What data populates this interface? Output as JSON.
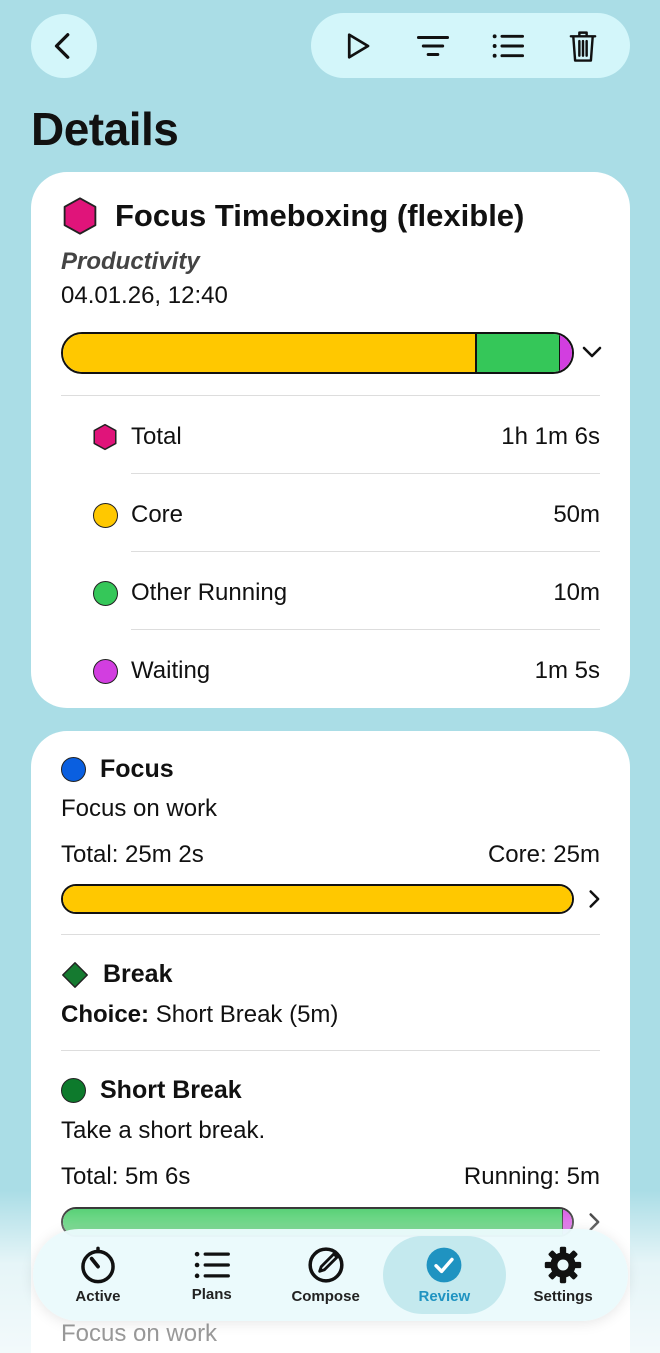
{
  "header": {
    "title": "Details",
    "icons": [
      "back-icon",
      "play-icon",
      "filter-icon",
      "list-icon",
      "trash-icon"
    ]
  },
  "run": {
    "title": "Focus Timeboxing (flexible)",
    "category": "Productivity",
    "date": "04.01.26, 12:40",
    "bar_fractions": {
      "core": 0.81,
      "other": 0.165,
      "waiting": 0.025
    },
    "stats": [
      {
        "label": "Total",
        "value": "1h 1m 6s",
        "marker": "hexagon",
        "color": "#e0147a"
      },
      {
        "label": "Core",
        "value": "50m",
        "marker": "dot",
        "color": "#ffc800"
      },
      {
        "label": "Other Running",
        "value": "10m",
        "marker": "dot",
        "color": "#35c759"
      },
      {
        "label": "Waiting",
        "value": "1m 5s",
        "marker": "dot",
        "color": "#d23ee0"
      }
    ]
  },
  "steps": [
    {
      "name": "Focus",
      "description": "Focus on work",
      "total": "Total: 25m 2s",
      "right": "Core: 25m",
      "color": "#0a5fe0",
      "bar_fraction": 1.0
    },
    {
      "name": "Break",
      "choice_label": "Choice:",
      "choice_value": "Short Break (5m)",
      "color": "#157a30"
    },
    {
      "name": "Short Break",
      "description": "Take a short break.",
      "total": "Total: 5m 6s",
      "right": "Running: 5m",
      "color": "#0d7a2c",
      "bar_fraction": 0.98
    }
  ],
  "ghost_text": "Focus on work",
  "tabs": [
    {
      "label": "Active",
      "icon": "timer-icon"
    },
    {
      "label": "Plans",
      "icon": "list-icon"
    },
    {
      "label": "Compose",
      "icon": "compose-icon"
    },
    {
      "label": "Review",
      "icon": "checkmark-icon",
      "selected": true
    },
    {
      "label": "Settings",
      "icon": "gear-icon"
    }
  ],
  "colors": {
    "background": "#aadde6",
    "core": "#ffc800",
    "other": "#35c759",
    "waiting": "#d23ee0",
    "accent": "#1f93c1"
  }
}
